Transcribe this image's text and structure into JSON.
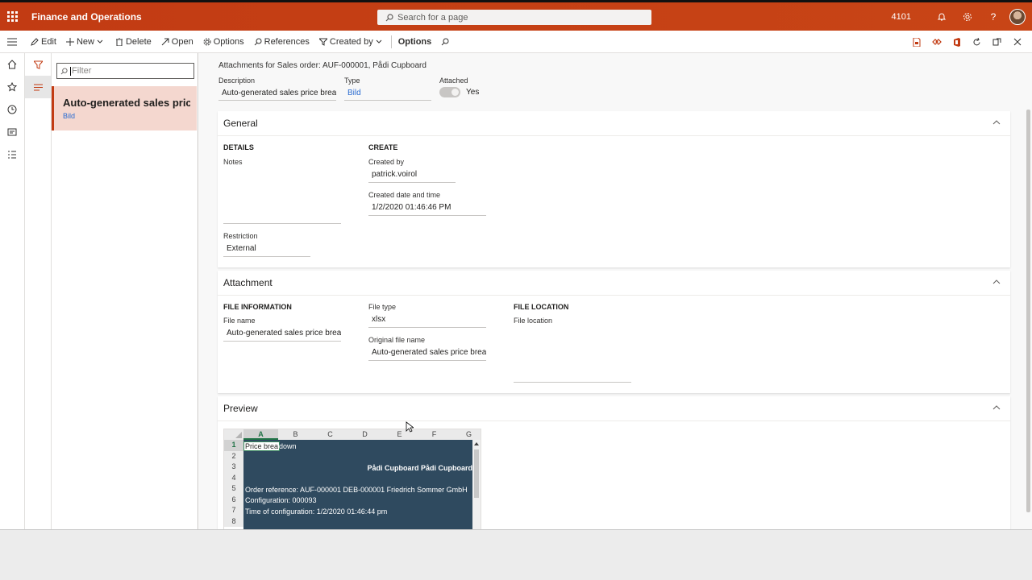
{
  "app": {
    "title": "Finance and Operations",
    "search_placeholder": "Search for a page",
    "company": "4101"
  },
  "actions": {
    "edit": "Edit",
    "new": "New",
    "delete": "Delete",
    "open": "Open",
    "options": "Options",
    "references": "References",
    "created_by": "Created by",
    "options_tab": "Options"
  },
  "list": {
    "filter_placeholder": "Filter",
    "item_title": "Auto-generated sales price ...",
    "item_sub": "Bild"
  },
  "header": {
    "caption": "Attachments for Sales order: AUF-000001, Pådi Cupboard",
    "description_label": "Description",
    "description_value": "Auto-generated sales price brea...",
    "type_label": "Type",
    "type_value": "Bild",
    "attached_label": "Attached",
    "attached_value": "Yes"
  },
  "general": {
    "title": "General",
    "details_title": "DETAILS",
    "notes_label": "Notes",
    "restriction_label": "Restriction",
    "restriction_value": "External",
    "create_title": "CREATE",
    "created_by_label": "Created by",
    "created_by_value": "patrick.voirol",
    "created_dt_label": "Created date and time",
    "created_dt_value": "1/2/2020 01:46:46 PM"
  },
  "attachment": {
    "title": "Attachment",
    "file_info_title": "FILE INFORMATION",
    "file_name_label": "File name",
    "file_name_value": "Auto-generated sales price brea...",
    "file_type_label": "File type",
    "file_type_value": "xlsx",
    "orig_name_label": "Original file name",
    "orig_name_value": "Auto-generated sales price brea...",
    "file_loc_title": "FILE LOCATION",
    "file_loc_label": "File location"
  },
  "preview": {
    "title": "Preview",
    "columns": [
      "A",
      "B",
      "C",
      "D",
      "E",
      "F",
      "G"
    ],
    "rows": [
      "1",
      "2",
      "3",
      "4",
      "5",
      "6",
      "7",
      "8"
    ],
    "cells": {
      "r1": "Price brea",
      "r1_rest": "down",
      "r3": "Pådi Cupboard Pådi Cupboard",
      "r5": "Order reference: AUF-000001 DEB-000001 Friedrich Sommer GmbH",
      "r6": "Configuration: 000093",
      "r7": "Time of configuration: 1/2/2020 01:46:44 pm"
    }
  },
  "colors": {
    "brand": "#c23b13",
    "link": "#2b6cd1",
    "sheet_bg": "#2f4a5f",
    "excel_green": "#217346"
  }
}
